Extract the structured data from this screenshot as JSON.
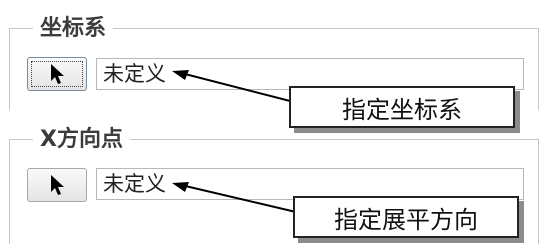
{
  "coordinate_system": {
    "group_title": "坐标系",
    "select_button_icon": "cursor-arrow-icon",
    "field_value": "未定义",
    "callout": "指定坐标系"
  },
  "x_direction_point": {
    "group_title": "X方向点",
    "select_button_icon": "cursor-arrow-icon",
    "field_value": "未定义",
    "callout": "指定展平方向"
  },
  "colors": {
    "frame": "#c6c6c6",
    "title_text": "#3c3c3c",
    "callout_shadow": "#8c8c8c"
  }
}
